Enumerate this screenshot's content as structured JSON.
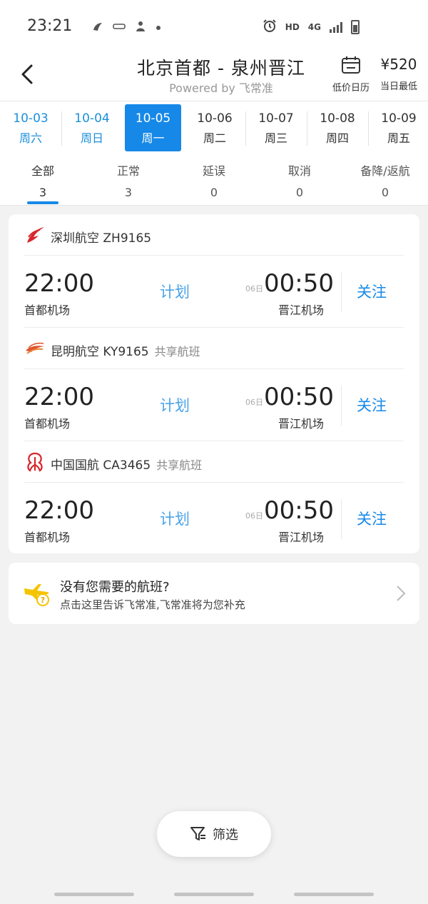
{
  "status_bar": {
    "time": "23:21",
    "left_icons": [
      "xiaohongshu-icon",
      "app-icon",
      "person-icon",
      "dot-icon"
    ],
    "network_hd": "HD",
    "network_type": "4G"
  },
  "header": {
    "title": "北京首都 - 泉州晋江",
    "subtitle": "Powered by 飞常准",
    "calendar_label": "低价日历",
    "lowest_price": "¥520",
    "lowest_price_label": "当日最低"
  },
  "dates": [
    {
      "date": "10-03",
      "weekday": "周六",
      "state": "past"
    },
    {
      "date": "10-04",
      "weekday": "周日",
      "state": "past"
    },
    {
      "date": "10-05",
      "weekday": "周一",
      "state": "selected"
    },
    {
      "date": "10-06",
      "weekday": "周二",
      "state": "future"
    },
    {
      "date": "10-07",
      "weekday": "周三",
      "state": "future"
    },
    {
      "date": "10-08",
      "weekday": "周四",
      "state": "future"
    },
    {
      "date": "10-09",
      "weekday": "周五",
      "state": "future"
    }
  ],
  "status_tabs": [
    {
      "label": "全部",
      "count": "3"
    },
    {
      "label": "正常",
      "count": "3"
    },
    {
      "label": "延误",
      "count": "0"
    },
    {
      "label": "取消",
      "count": "0"
    },
    {
      "label": "备降/返航",
      "count": "0"
    }
  ],
  "flights": [
    {
      "airline": "深圳航空 ZH9165",
      "share_label": "",
      "logo": "shenzhen-airlines-logo",
      "dep_time": "22:00",
      "dep_airport": "首都机场",
      "status": "计划",
      "next_day": "06日",
      "arr_time": "00:50",
      "arr_airport": "晋江机场",
      "follow_label": "关注"
    },
    {
      "airline": "昆明航空 KY9165",
      "share_label": "共享航班",
      "logo": "kunming-airlines-logo",
      "dep_time": "22:00",
      "dep_airport": "首都机场",
      "status": "计划",
      "next_day": "06日",
      "arr_time": "00:50",
      "arr_airport": "晋江机场",
      "follow_label": "关注"
    },
    {
      "airline": "中国国航 CA3465",
      "share_label": "共享航班",
      "logo": "air-china-logo",
      "dep_time": "22:00",
      "dep_airport": "首都机场",
      "status": "计划",
      "next_day": "06日",
      "arr_time": "00:50",
      "arr_airport": "晋江机场",
      "follow_label": "关注"
    }
  ],
  "missing": {
    "title": "没有您需要的航班?",
    "subtitle": "点击这里告诉飞常准,飞常准将为您补充"
  },
  "filter": {
    "label": "筛选"
  },
  "colors": {
    "accent": "#1688e8",
    "status_planned": "#4aa3e8",
    "page_bg": "#f2f2f2"
  }
}
